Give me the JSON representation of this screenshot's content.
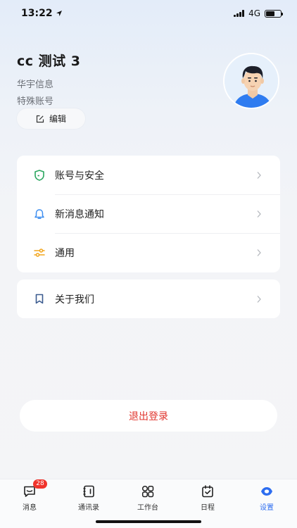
{
  "status_bar": {
    "time": "13:22",
    "network": "4G",
    "battery_level": 0.6
  },
  "profile": {
    "name": "cc 测试 3",
    "company": "华宇信息",
    "account_type": "特殊账号",
    "edit_label": "编辑"
  },
  "menu": {
    "items": [
      {
        "label": "账号与安全",
        "icon": "shield-icon",
        "color": "#2aa65f"
      },
      {
        "label": "新消息通知",
        "icon": "bell-icon",
        "color": "#3d8ef0"
      },
      {
        "label": "通用",
        "icon": "sliders-icon",
        "color": "#f2a51d"
      }
    ],
    "about": {
      "label": "关于我们",
      "icon": "bookmark-icon",
      "color": "#3b5b8f"
    }
  },
  "logout_label": "退出登录",
  "tabs": [
    {
      "label": "消息",
      "badge": "28",
      "active": false
    },
    {
      "label": "通讯录",
      "active": false
    },
    {
      "label": "工作台",
      "active": false
    },
    {
      "label": "日程",
      "active": false
    },
    {
      "label": "设置",
      "active": true
    }
  ],
  "colors": {
    "accent": "#2d6df0",
    "danger": "#e0342c",
    "badge": "#f0342c"
  }
}
